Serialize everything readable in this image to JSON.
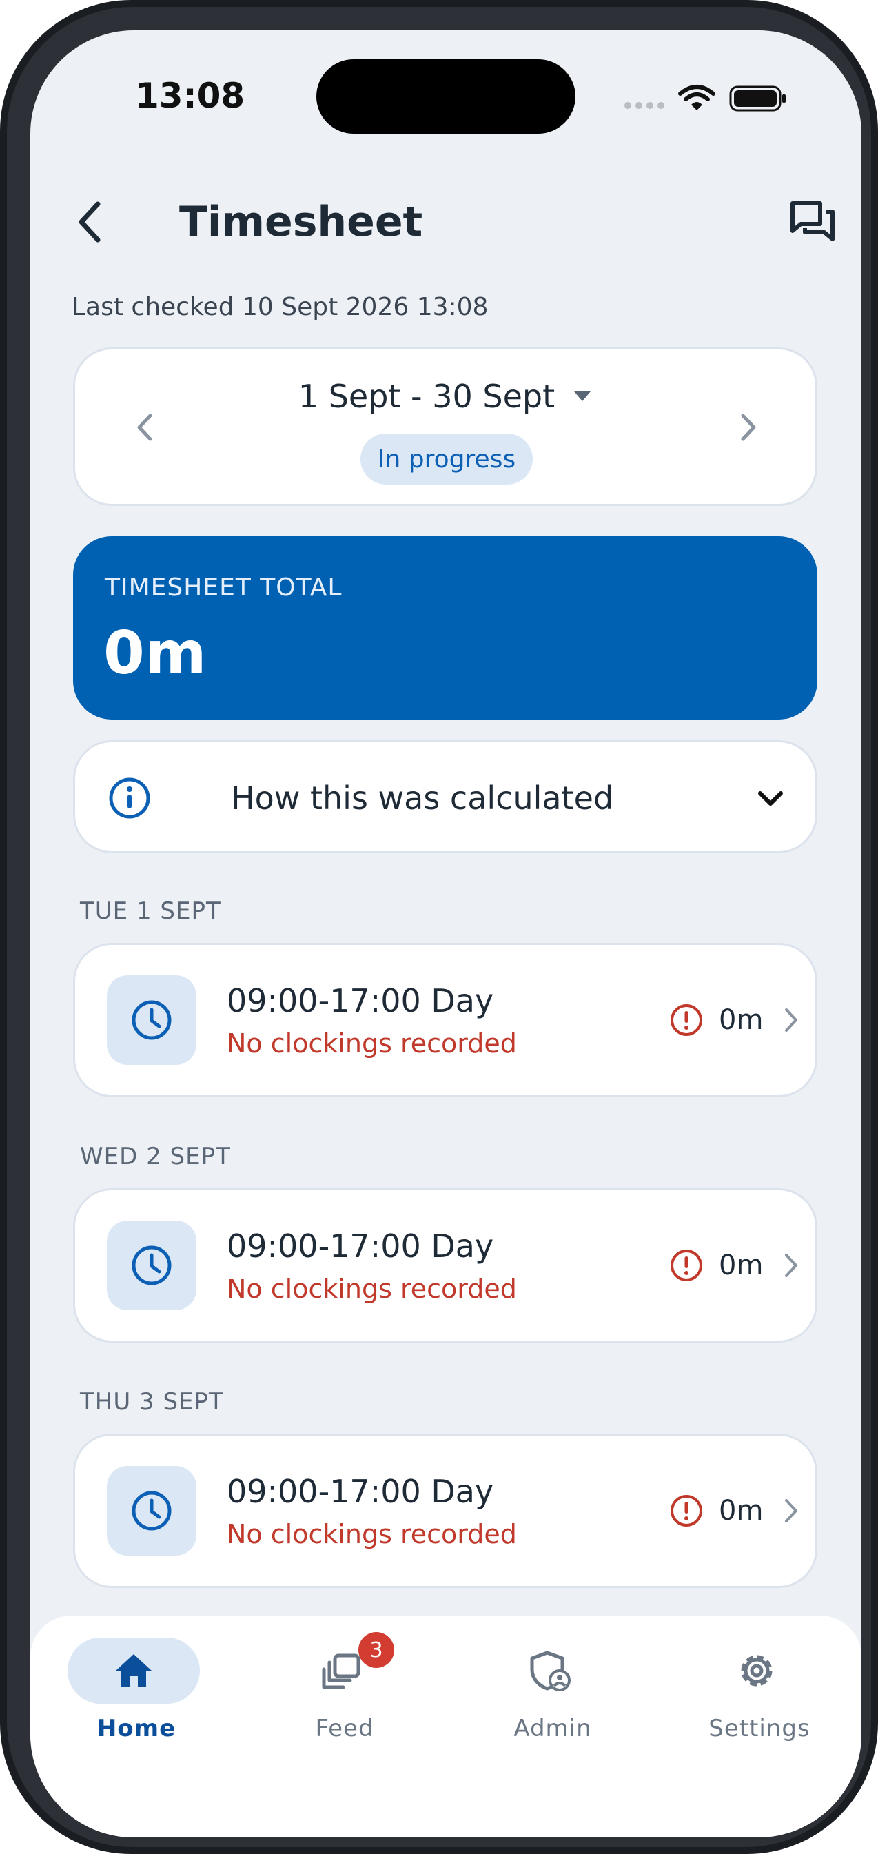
{
  "status_bar": {
    "time": "13:08"
  },
  "header": {
    "title": "Timesheet",
    "back_icon": "chevron-left-icon",
    "messages_icon": "chat-bubbles-icon"
  },
  "last_checked": "Last checked 10 Sept 2026 13:08",
  "period": {
    "label": "1 Sept - 30 Sept",
    "status": "In progress"
  },
  "total": {
    "label": "TIMESHEET TOTAL",
    "value": "0m"
  },
  "calculation": {
    "label": "How this was calculated"
  },
  "days": [
    {
      "heading": "TUE 1 SEPT",
      "shift": "09:00-17:00 Day",
      "status": "No clockings recorded",
      "duration": "0m"
    },
    {
      "heading": "WED 2 SEPT",
      "shift": "09:00-17:00 Day",
      "status": "No clockings recorded",
      "duration": "0m"
    },
    {
      "heading": "THU 3 SEPT",
      "shift": "09:00-17:00 Day",
      "status": "No clockings recorded",
      "duration": "0m"
    }
  ],
  "nav": {
    "items": [
      {
        "label": "Home",
        "icon": "home-icon",
        "active": true
      },
      {
        "label": "Feed",
        "icon": "stack-icon",
        "badge": "3"
      },
      {
        "label": "Admin",
        "icon": "shield-user-icon"
      },
      {
        "label": "Settings",
        "icon": "gear-icon"
      }
    ]
  },
  "colors": {
    "brand": "#0061b3",
    "error": "#c0392b",
    "background": "#edf1f6"
  }
}
